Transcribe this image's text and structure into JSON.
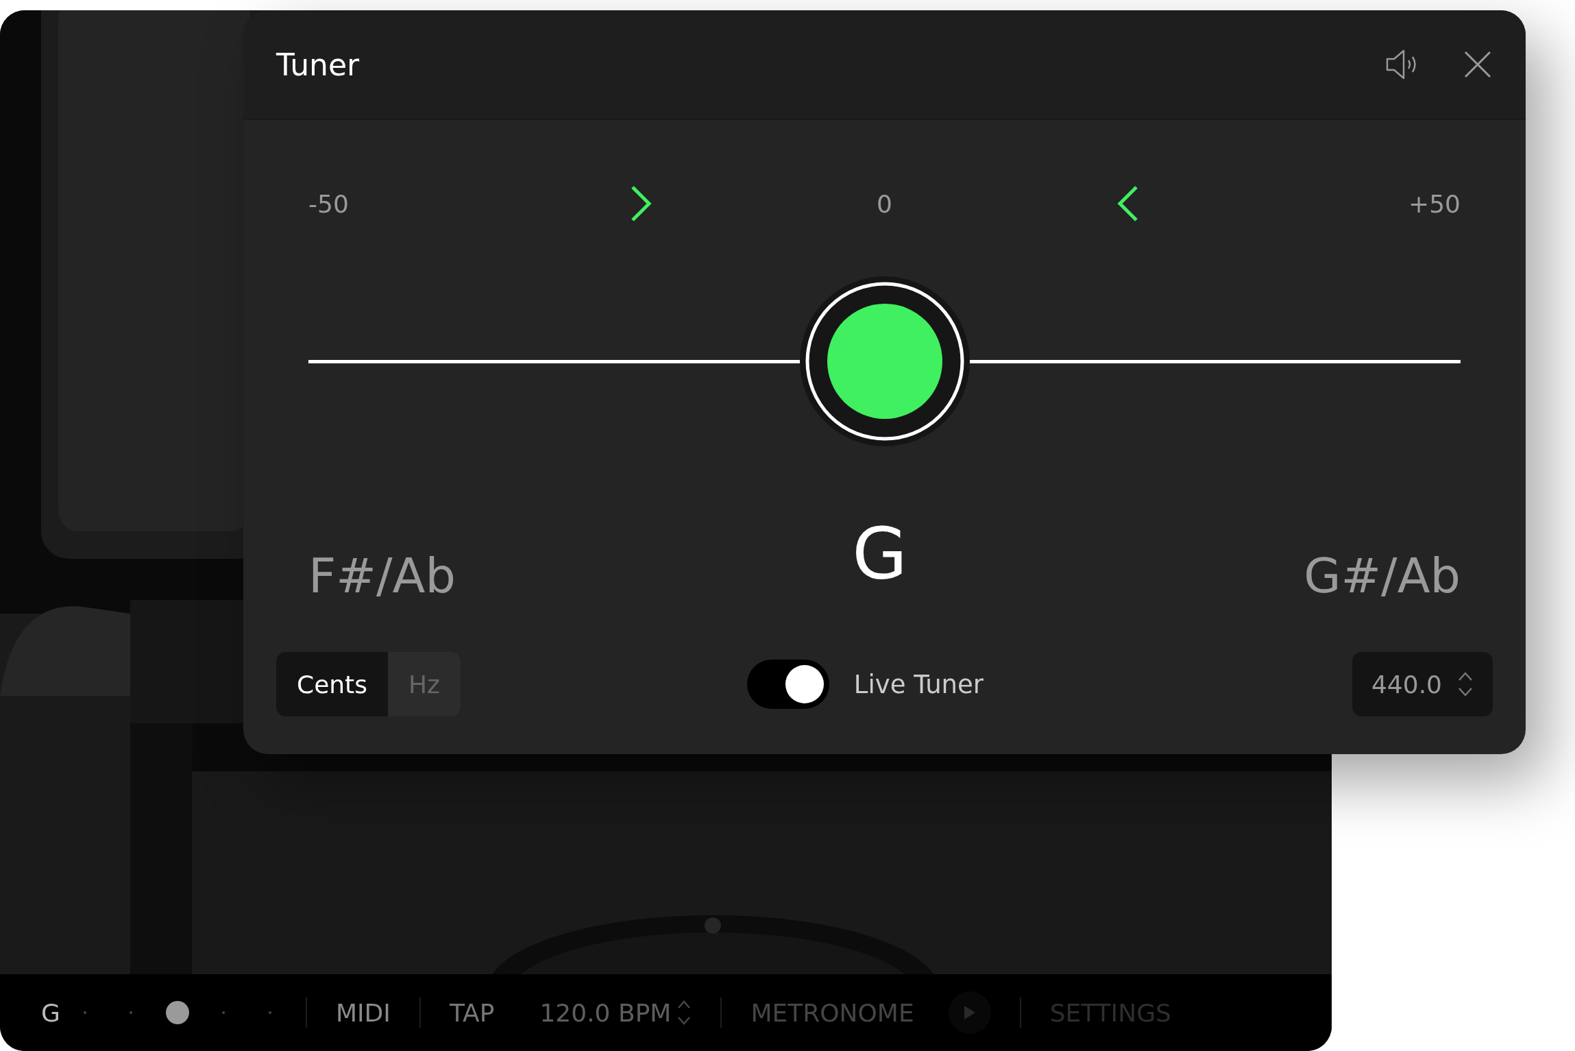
{
  "tuner": {
    "title": "Tuner",
    "scale": [
      "-50",
      "0",
      "+50"
    ],
    "in_tune": true,
    "notes": {
      "flat": "F#/Ab",
      "current": "G",
      "sharp": "G#/Ab"
    },
    "units": [
      {
        "label": "Cents",
        "selected": true
      },
      {
        "label": "Hz",
        "selected": false
      }
    ],
    "live_tuner": {
      "label": "Live Tuner",
      "on": true
    },
    "reference": "440.0"
  },
  "bottom_bar": {
    "note": "G",
    "mini_tuner": {
      "level": 0.5
    },
    "midi": "MIDI",
    "tap": "TAP",
    "tempo": "120.0 BPM",
    "metronome": "METRONOME",
    "settings": "SETTINGS"
  }
}
